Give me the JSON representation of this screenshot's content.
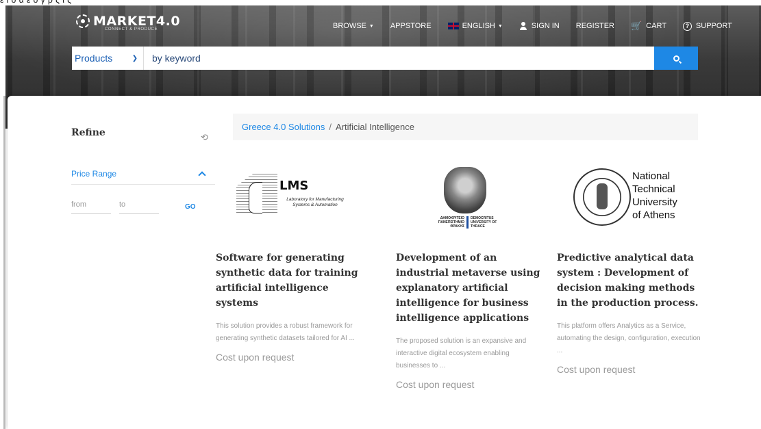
{
  "header": {
    "logo_text": "MARKET4.0",
    "logo_tagline": "CONNECT & PRODUCE",
    "nav": {
      "browse": "BROWSE",
      "appstore": "APPSTORE",
      "language": "ENGLISH",
      "sign_in": "SIGN IN",
      "register": "REGISTER",
      "cart": "CART",
      "support": "SUPPORT"
    },
    "search": {
      "category": "Products",
      "placeholder": "by keyword"
    }
  },
  "sidebar": {
    "title": "Refine",
    "price_range": {
      "label": "Price Range",
      "from_placeholder": "from",
      "to_placeholder": "to",
      "go_label": "GO"
    }
  },
  "breadcrumb": {
    "parent": "Greece 4.0 Solutions",
    "separator": "/",
    "current": "Artificial Intelligence"
  },
  "products": [
    {
      "title": "Software for generating synthetic data for training artificial intelligence systems",
      "description": "This solution provides a robust framework for generating synthetic datasets tailored for AI ...",
      "cost": "Cost upon request",
      "logo": {
        "name": "LMS",
        "subtitle": "Laboratory for Manufacturing Systems & Automation"
      }
    },
    {
      "title": "Development of an industrial metaverse using explanatory artificial intelligence for business intelligence applications",
      "description": "The proposed solution is an expansive and interactive digital ecosystem enabling businesses to ...",
      "cost": "Cost upon request",
      "logo": {
        "left_text": "ΔΗΜΟΚΡΙΤΕΙΟ ΠΑΝΕΠΙΣΤΗΜΙΟ ΘΡΑΚΗΣ",
        "right_text": "DEMOCRITUS UNIVERSITY OF THRACE"
      }
    },
    {
      "title": "Predictive analytical data system : Development of decision making methods in the production process.",
      "description": "This platform offers Analytics as a Service, automating the design, configuration, execution ...",
      "cost": "Cost upon request",
      "logo": {
        "line1": "National",
        "line2": "Technical",
        "line3": "University",
        "line4": "of Athens"
      }
    }
  ],
  "colors": {
    "accent": "#1e88e5",
    "title_text": "#333333",
    "muted_text": "#9a9a9a"
  }
}
